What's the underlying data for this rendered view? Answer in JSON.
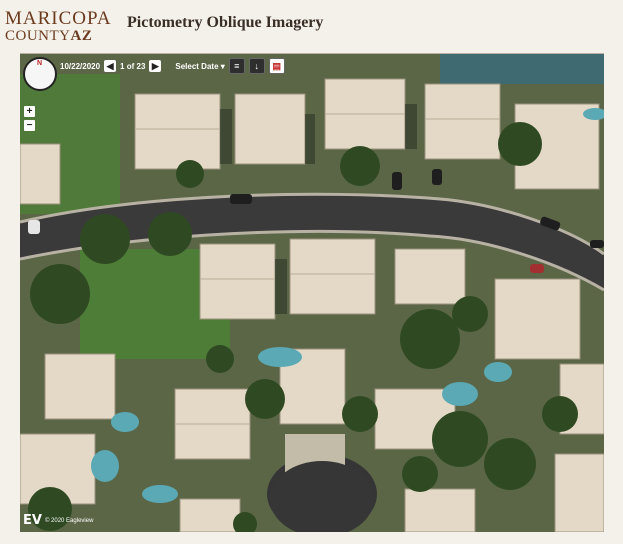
{
  "header": {
    "logo_line1": "MARICOPA",
    "logo_county": "COUNTY",
    "logo_az": "AZ",
    "title": "Pictometry Oblique Imagery"
  },
  "viewer": {
    "date": "10/22/2020",
    "page_info": "1 of 23",
    "prev_icon": "◀",
    "next_icon": "▶",
    "select_date_label": "Select Date ▾",
    "compass_label": "N",
    "zoom_in": "+",
    "zoom_out": "−",
    "credit": "© 2020 Eagleview",
    "credit_mark": "EV"
  }
}
